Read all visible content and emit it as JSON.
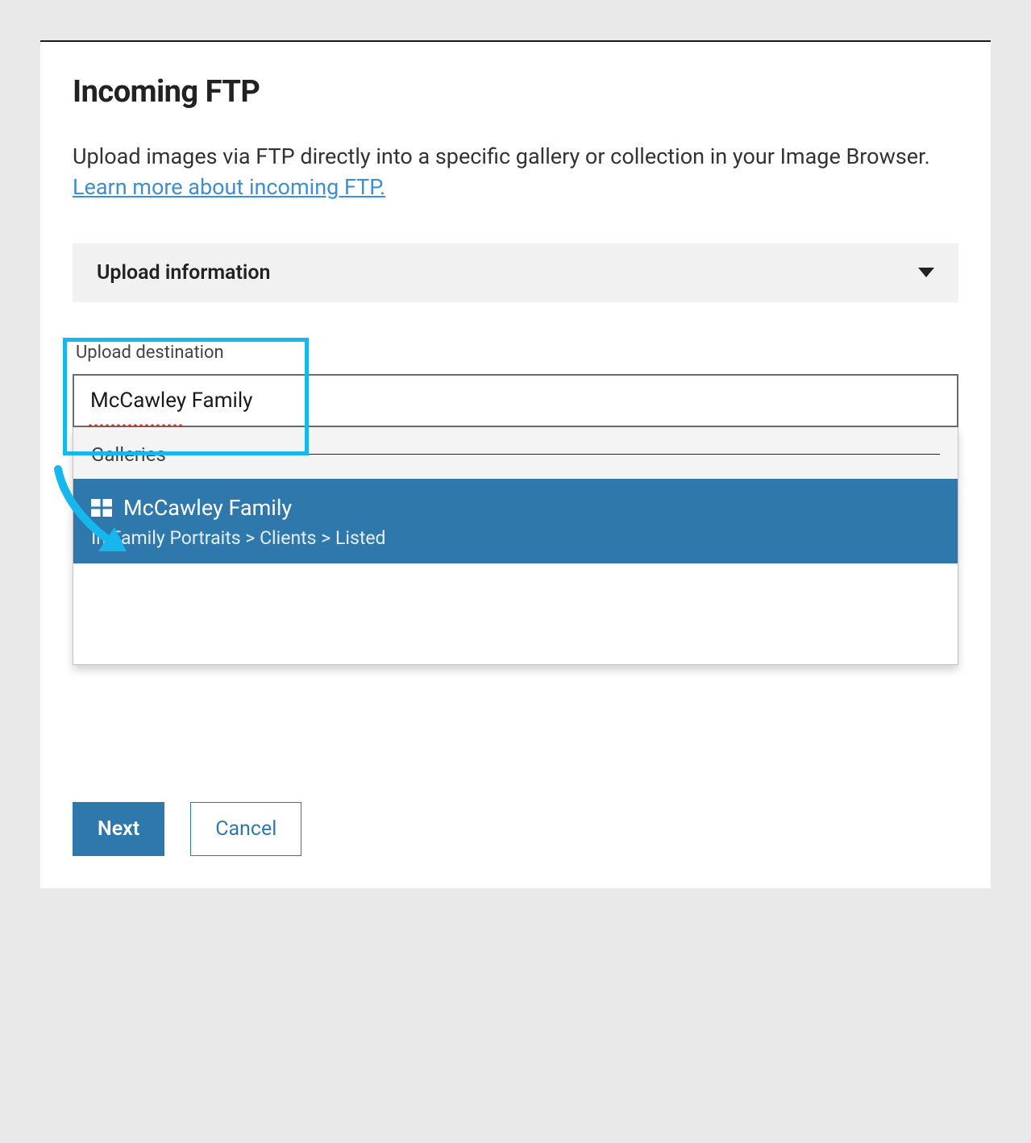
{
  "page": {
    "title": "Incoming FTP",
    "intro_before_link": "Upload images via FTP directly into a specific gallery or collection in your Image Browser. ",
    "intro_link": "Learn more about incoming FTP."
  },
  "accordion": {
    "label": "Upload information"
  },
  "destination": {
    "label": "Upload destination",
    "value": "McCawley Family"
  },
  "dropdown": {
    "section_label": "Galleries",
    "item_title": "McCawley Family",
    "item_path": "In Family Portraits > Clients > Listed"
  },
  "buttons": {
    "next": "Next",
    "cancel": "Cancel"
  }
}
